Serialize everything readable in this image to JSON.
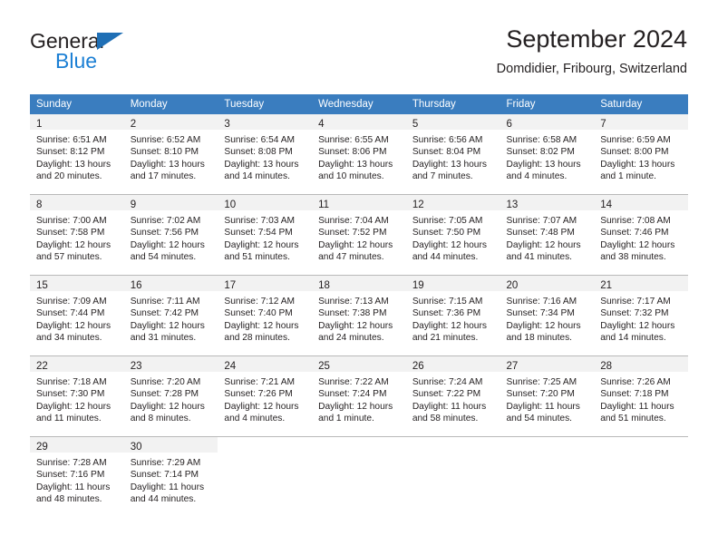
{
  "brand": {
    "name_top": "General",
    "name_bottom": "Blue",
    "triangle_color": "#1f6fb5",
    "blue_color": "#1b7fd4"
  },
  "header": {
    "title": "September 2024",
    "subtitle": "Domdidier, Fribourg, Switzerland"
  },
  "theme": {
    "header_row_bg": "#3a7dbf",
    "header_row_fg": "#ffffff",
    "daynum_band_bg": "#f2f2f2",
    "grid_line": "#b9b9b9",
    "text": "#231f20"
  },
  "calendar": {
    "columns": [
      "Sunday",
      "Monday",
      "Tuesday",
      "Wednesday",
      "Thursday",
      "Friday",
      "Saturday"
    ],
    "weeks": [
      [
        {
          "day": "1",
          "sunrise": "Sunrise: 6:51 AM",
          "sunset": "Sunset: 8:12 PM",
          "daylight1": "Daylight: 13 hours",
          "daylight2": "and 20 minutes."
        },
        {
          "day": "2",
          "sunrise": "Sunrise: 6:52 AM",
          "sunset": "Sunset: 8:10 PM",
          "daylight1": "Daylight: 13 hours",
          "daylight2": "and 17 minutes."
        },
        {
          "day": "3",
          "sunrise": "Sunrise: 6:54 AM",
          "sunset": "Sunset: 8:08 PM",
          "daylight1": "Daylight: 13 hours",
          "daylight2": "and 14 minutes."
        },
        {
          "day": "4",
          "sunrise": "Sunrise: 6:55 AM",
          "sunset": "Sunset: 8:06 PM",
          "daylight1": "Daylight: 13 hours",
          "daylight2": "and 10 minutes."
        },
        {
          "day": "5",
          "sunrise": "Sunrise: 6:56 AM",
          "sunset": "Sunset: 8:04 PM",
          "daylight1": "Daylight: 13 hours",
          "daylight2": "and 7 minutes."
        },
        {
          "day": "6",
          "sunrise": "Sunrise: 6:58 AM",
          "sunset": "Sunset: 8:02 PM",
          "daylight1": "Daylight: 13 hours",
          "daylight2": "and 4 minutes."
        },
        {
          "day": "7",
          "sunrise": "Sunrise: 6:59 AM",
          "sunset": "Sunset: 8:00 PM",
          "daylight1": "Daylight: 13 hours",
          "daylight2": "and 1 minute."
        }
      ],
      [
        {
          "day": "8",
          "sunrise": "Sunrise: 7:00 AM",
          "sunset": "Sunset: 7:58 PM",
          "daylight1": "Daylight: 12 hours",
          "daylight2": "and 57 minutes."
        },
        {
          "day": "9",
          "sunrise": "Sunrise: 7:02 AM",
          "sunset": "Sunset: 7:56 PM",
          "daylight1": "Daylight: 12 hours",
          "daylight2": "and 54 minutes."
        },
        {
          "day": "10",
          "sunrise": "Sunrise: 7:03 AM",
          "sunset": "Sunset: 7:54 PM",
          "daylight1": "Daylight: 12 hours",
          "daylight2": "and 51 minutes."
        },
        {
          "day": "11",
          "sunrise": "Sunrise: 7:04 AM",
          "sunset": "Sunset: 7:52 PM",
          "daylight1": "Daylight: 12 hours",
          "daylight2": "and 47 minutes."
        },
        {
          "day": "12",
          "sunrise": "Sunrise: 7:05 AM",
          "sunset": "Sunset: 7:50 PM",
          "daylight1": "Daylight: 12 hours",
          "daylight2": "and 44 minutes."
        },
        {
          "day": "13",
          "sunrise": "Sunrise: 7:07 AM",
          "sunset": "Sunset: 7:48 PM",
          "daylight1": "Daylight: 12 hours",
          "daylight2": "and 41 minutes."
        },
        {
          "day": "14",
          "sunrise": "Sunrise: 7:08 AM",
          "sunset": "Sunset: 7:46 PM",
          "daylight1": "Daylight: 12 hours",
          "daylight2": "and 38 minutes."
        }
      ],
      [
        {
          "day": "15",
          "sunrise": "Sunrise: 7:09 AM",
          "sunset": "Sunset: 7:44 PM",
          "daylight1": "Daylight: 12 hours",
          "daylight2": "and 34 minutes."
        },
        {
          "day": "16",
          "sunrise": "Sunrise: 7:11 AM",
          "sunset": "Sunset: 7:42 PM",
          "daylight1": "Daylight: 12 hours",
          "daylight2": "and 31 minutes."
        },
        {
          "day": "17",
          "sunrise": "Sunrise: 7:12 AM",
          "sunset": "Sunset: 7:40 PM",
          "daylight1": "Daylight: 12 hours",
          "daylight2": "and 28 minutes."
        },
        {
          "day": "18",
          "sunrise": "Sunrise: 7:13 AM",
          "sunset": "Sunset: 7:38 PM",
          "daylight1": "Daylight: 12 hours",
          "daylight2": "and 24 minutes."
        },
        {
          "day": "19",
          "sunrise": "Sunrise: 7:15 AM",
          "sunset": "Sunset: 7:36 PM",
          "daylight1": "Daylight: 12 hours",
          "daylight2": "and 21 minutes."
        },
        {
          "day": "20",
          "sunrise": "Sunrise: 7:16 AM",
          "sunset": "Sunset: 7:34 PM",
          "daylight1": "Daylight: 12 hours",
          "daylight2": "and 18 minutes."
        },
        {
          "day": "21",
          "sunrise": "Sunrise: 7:17 AM",
          "sunset": "Sunset: 7:32 PM",
          "daylight1": "Daylight: 12 hours",
          "daylight2": "and 14 minutes."
        }
      ],
      [
        {
          "day": "22",
          "sunrise": "Sunrise: 7:18 AM",
          "sunset": "Sunset: 7:30 PM",
          "daylight1": "Daylight: 12 hours",
          "daylight2": "and 11 minutes."
        },
        {
          "day": "23",
          "sunrise": "Sunrise: 7:20 AM",
          "sunset": "Sunset: 7:28 PM",
          "daylight1": "Daylight: 12 hours",
          "daylight2": "and 8 minutes."
        },
        {
          "day": "24",
          "sunrise": "Sunrise: 7:21 AM",
          "sunset": "Sunset: 7:26 PM",
          "daylight1": "Daylight: 12 hours",
          "daylight2": "and 4 minutes."
        },
        {
          "day": "25",
          "sunrise": "Sunrise: 7:22 AM",
          "sunset": "Sunset: 7:24 PM",
          "daylight1": "Daylight: 12 hours",
          "daylight2": "and 1 minute."
        },
        {
          "day": "26",
          "sunrise": "Sunrise: 7:24 AM",
          "sunset": "Sunset: 7:22 PM",
          "daylight1": "Daylight: 11 hours",
          "daylight2": "and 58 minutes."
        },
        {
          "day": "27",
          "sunrise": "Sunrise: 7:25 AM",
          "sunset": "Sunset: 7:20 PM",
          "daylight1": "Daylight: 11 hours",
          "daylight2": "and 54 minutes."
        },
        {
          "day": "28",
          "sunrise": "Sunrise: 7:26 AM",
          "sunset": "Sunset: 7:18 PM",
          "daylight1": "Daylight: 11 hours",
          "daylight2": "and 51 minutes."
        }
      ],
      [
        {
          "day": "29",
          "sunrise": "Sunrise: 7:28 AM",
          "sunset": "Sunset: 7:16 PM",
          "daylight1": "Daylight: 11 hours",
          "daylight2": "and 48 minutes."
        },
        {
          "day": "30",
          "sunrise": "Sunrise: 7:29 AM",
          "sunset": "Sunset: 7:14 PM",
          "daylight1": "Daylight: 11 hours",
          "daylight2": "and 44 minutes."
        },
        {
          "day": "",
          "sunrise": "",
          "sunset": "",
          "daylight1": "",
          "daylight2": ""
        },
        {
          "day": "",
          "sunrise": "",
          "sunset": "",
          "daylight1": "",
          "daylight2": ""
        },
        {
          "day": "",
          "sunrise": "",
          "sunset": "",
          "daylight1": "",
          "daylight2": ""
        },
        {
          "day": "",
          "sunrise": "",
          "sunset": "",
          "daylight1": "",
          "daylight2": ""
        },
        {
          "day": "",
          "sunrise": "",
          "sunset": "",
          "daylight1": "",
          "daylight2": ""
        }
      ]
    ]
  }
}
